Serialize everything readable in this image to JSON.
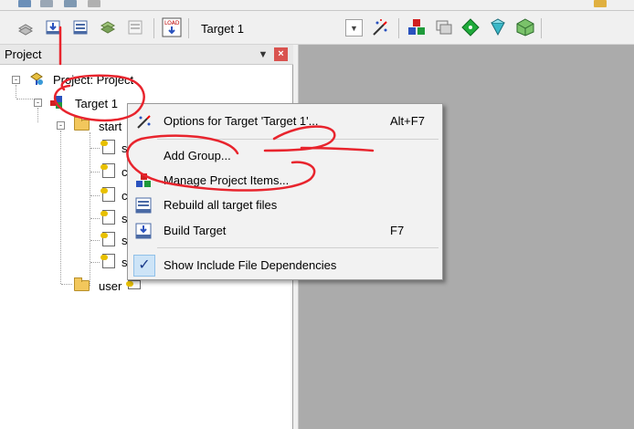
{
  "toolbar": {
    "target_value": "Target 1",
    "load_label": "LOAD"
  },
  "panel": {
    "title": "Project",
    "pin_icon": "pin-icon",
    "close_icon": "close-icon"
  },
  "tree": {
    "root_label": "Project: Project",
    "target_label": "Target 1",
    "group1_label": "start",
    "group1_files": [
      "s",
      "c",
      "c",
      "s",
      "s",
      "s"
    ],
    "group2_label": "user"
  },
  "context_menu": {
    "items": [
      {
        "label": "Options for Target 'Target 1'...",
        "shortcut": "Alt+F7",
        "icon": "options-wand-icon"
      },
      {
        "label": "Add Group...",
        "shortcut": "",
        "icon": ""
      },
      {
        "label": "Manage Project Items...",
        "shortcut": "",
        "icon": "manage-items-icon"
      },
      {
        "label": "Rebuild all target files",
        "shortcut": "",
        "icon": "rebuild-icon"
      },
      {
        "label": "Build Target",
        "shortcut": "F7",
        "icon": "build-icon"
      },
      {
        "label": "Show Include File Dependencies",
        "shortcut": "",
        "icon": "checkmark-icon",
        "checked": true
      }
    ]
  },
  "colors": {
    "annotation_red": "#e8242d",
    "menu_bg": "#f2f2f2",
    "workspace_gray": "#ababab"
  }
}
